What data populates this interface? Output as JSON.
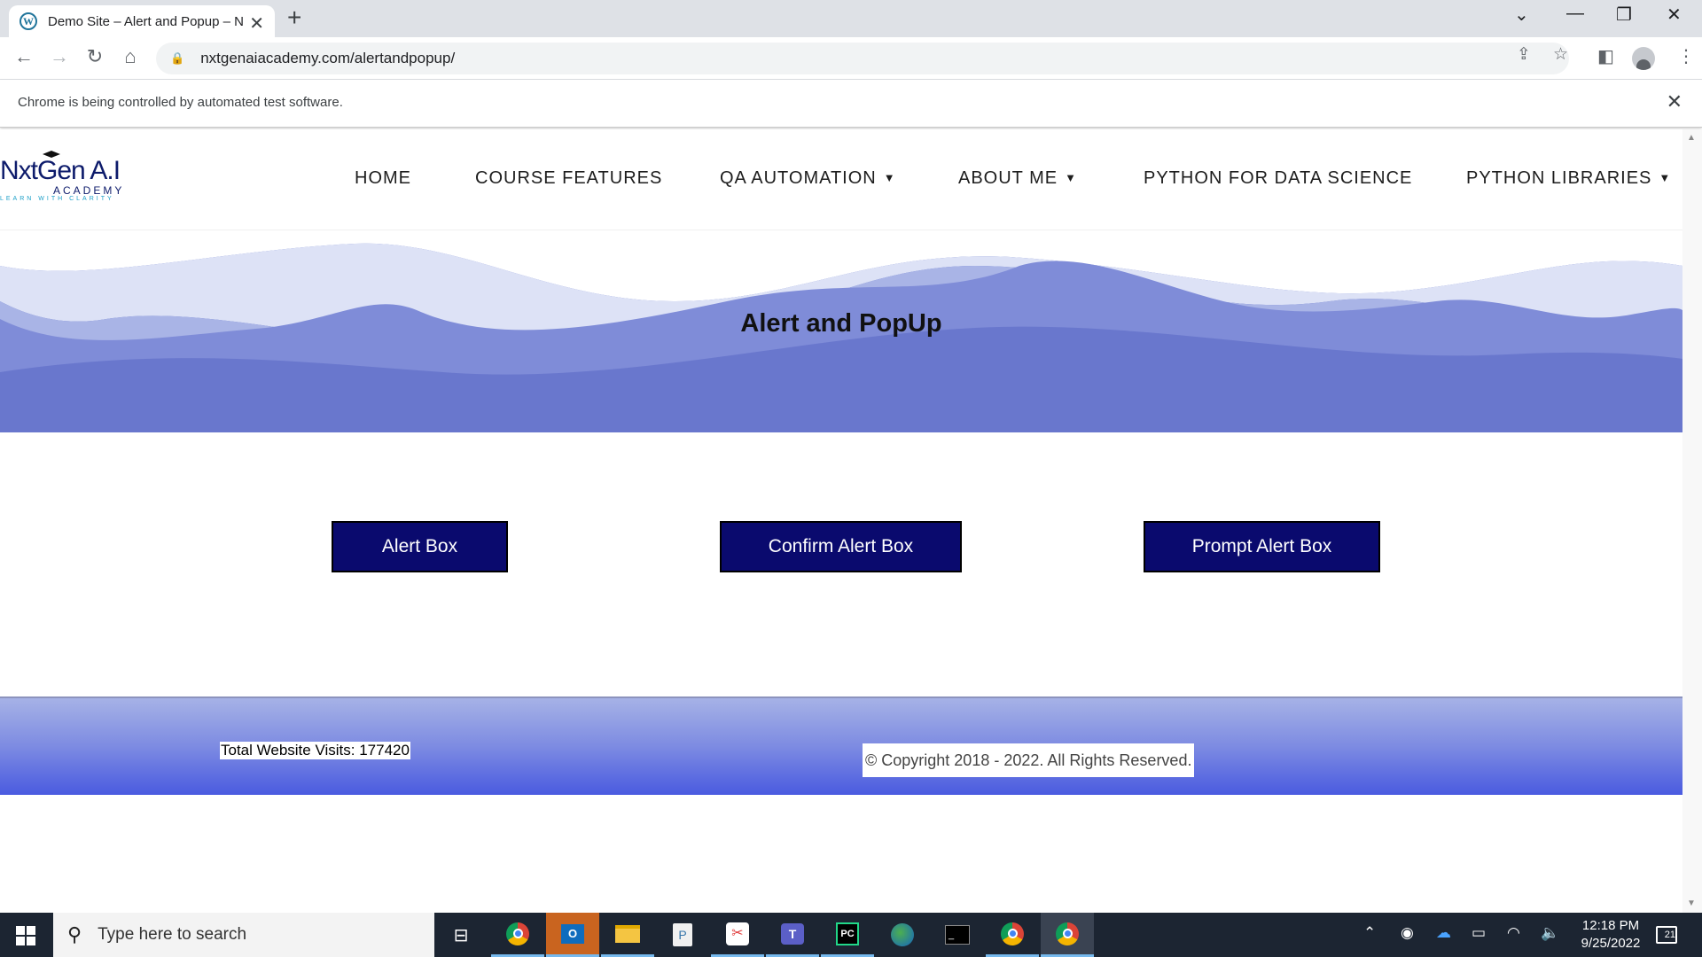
{
  "browser": {
    "tab_title": "Demo Site – Alert and Popup – N",
    "favicon_text": "W",
    "url": "nxtgenaiacademy.com/alertandpopup/",
    "infobar_text": "Chrome is being controlled by automated test software."
  },
  "site": {
    "logo_main": "NxtGen A.I",
    "logo_sub": "ACADEMY",
    "logo_tagline": "LEARN WITH CLARITY",
    "menu": [
      {
        "label": "HOME",
        "has_dropdown": false
      },
      {
        "label": "COURSE FEATURES",
        "has_dropdown": false
      },
      {
        "label": "QA AUTOMATION",
        "has_dropdown": true
      },
      {
        "label": "ABOUT ME",
        "has_dropdown": true
      },
      {
        "label": "PYTHON FOR DATA SCIENCE",
        "has_dropdown": false
      },
      {
        "label": "PYTHON LIBRARIES",
        "has_dropdown": true
      }
    ],
    "page_title": "Alert and PopUp",
    "buttons": {
      "alert": "Alert Box",
      "confirm": "Confirm Alert Box",
      "prompt": "Prompt Alert Box"
    },
    "footer": {
      "visits": "Total Website Visits: 177420",
      "copyright": "© Copyright 2018 - 2022. All Rights Reserved."
    },
    "colors": {
      "button_bg": "#0a0a6e",
      "hero_wave": "#5a6cc6",
      "footer_bottom": "#4a5be0"
    }
  },
  "taskbar": {
    "search_placeholder": "Type here to search",
    "time": "12:18 PM",
    "date": "9/25/2022",
    "notification_count": "21"
  }
}
